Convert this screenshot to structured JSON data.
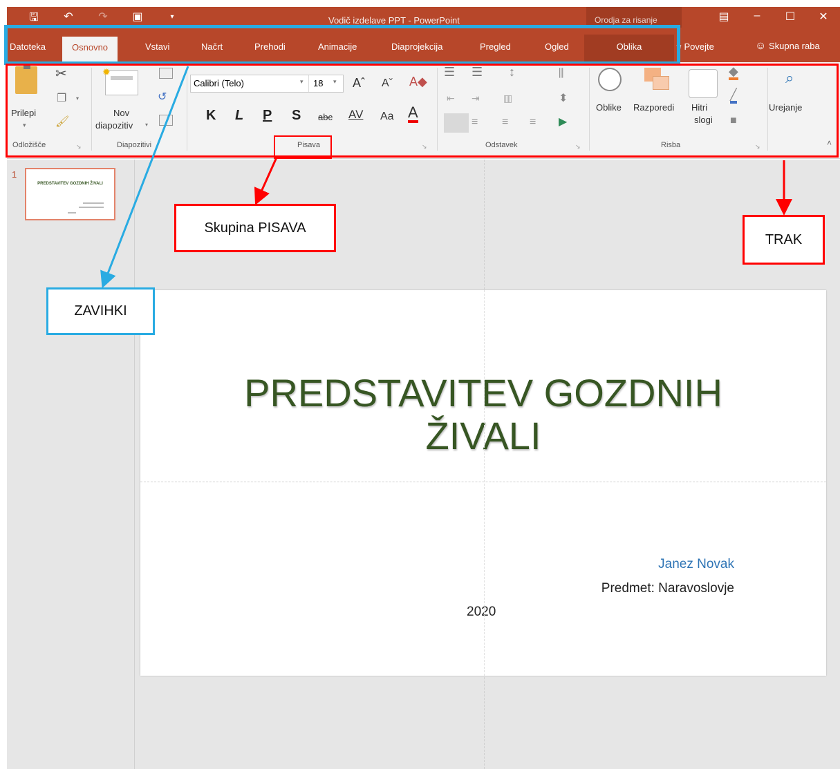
{
  "titlebar": {
    "document_title": "Vodič izdelave PPT - PowerPoint",
    "context_tools_title": "Orodja za risanje"
  },
  "tabs": [
    "Datoteka",
    "Osnovno",
    "Vstavi",
    "Načrt",
    "Prehodi",
    "Animacije",
    "Diaprojekcija",
    "Pregled",
    "Ogled",
    "Oblika"
  ],
  "active_tab": "Osnovno",
  "tell_me": "Povejte",
  "share": "Skupna raba",
  "ribbon": {
    "clipboard": {
      "paste": "Prilepi",
      "group": "Odložišče"
    },
    "slides": {
      "new_slide_1": "Nov",
      "new_slide_2": "diapozitiv",
      "group": "Diapozitivi"
    },
    "font": {
      "family": "Calibri (Telo)",
      "size": "18",
      "bold": "K",
      "italic": "L",
      "underline": "P",
      "shadow": "S",
      "strike": "abc",
      "spacing": "AV",
      "case": "Aa",
      "color": "A",
      "group": "Pisava"
    },
    "paragraph": {
      "group": "Odstavek"
    },
    "drawing": {
      "shapes": "Oblike",
      "arrange": "Razporedi",
      "quick_styles_1": "Hitri",
      "quick_styles_2": "slogi",
      "group": "Risba"
    },
    "editing": {
      "label": "Urejanje"
    }
  },
  "thumbnail": {
    "number": "1",
    "title": "PREDSTAVITEV GOZDNIH ŽIVALI"
  },
  "slide": {
    "title_line1": "PREDSTAVITEV GOZDNIH",
    "title_line2": "ŽIVALI",
    "author": "Janez Novak",
    "subject": "Predmet: Naravoslovje",
    "year": "2020"
  },
  "annotations": {
    "tabs_label": "ZAVIHKI",
    "font_group_label": "Skupina PISAVA",
    "ribbon_label": "TRAK"
  },
  "colors": {
    "accent": "#b7472a",
    "title_green": "#375623",
    "annotation_blue": "#29abe2",
    "annotation_red": "#ff0000"
  }
}
